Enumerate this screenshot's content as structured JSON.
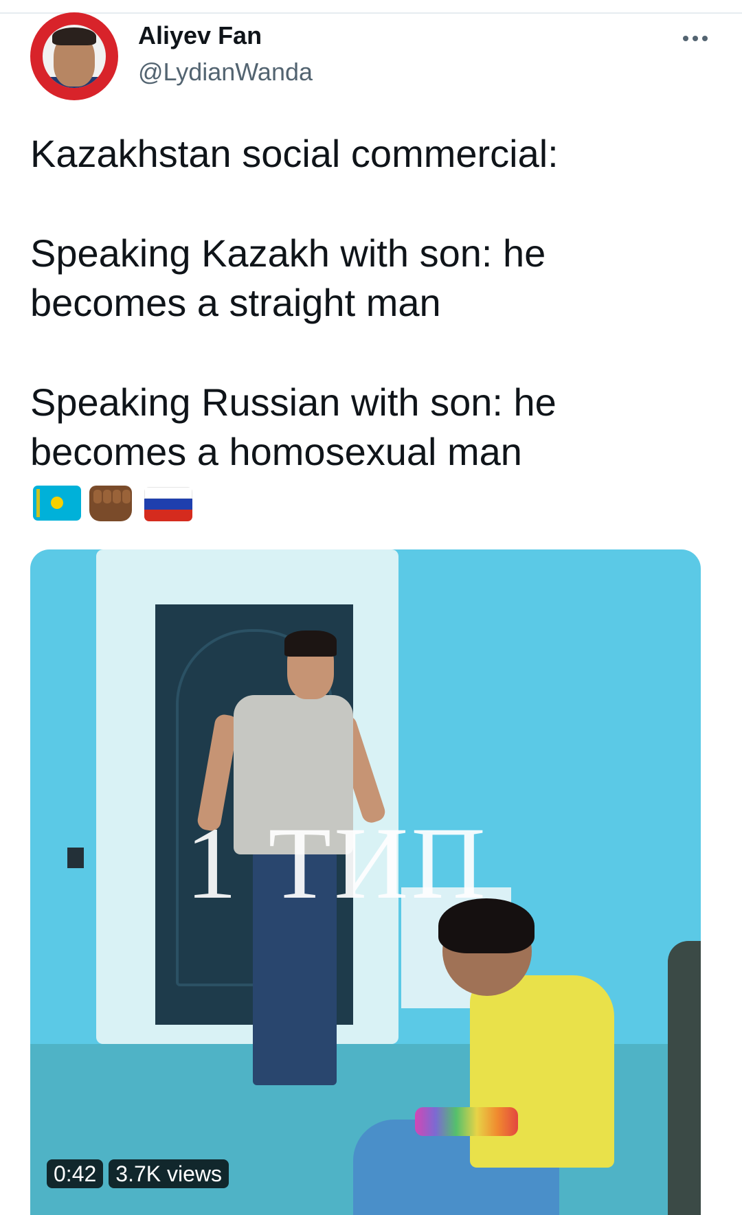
{
  "author": {
    "display_name": "Aliyev Fan",
    "handle": "@LydianWanda"
  },
  "tweet": {
    "line1": "Kazakhstan social commercial:",
    "para2_line1": "Speaking Kazakh with son: he",
    "para2_line2": "becomes a straight man",
    "para3_line1": "Speaking Russian with son: he",
    "para3_line2": "becomes a homosexual man",
    "emojis": [
      "flag-kazakhstan-icon",
      "raised-fist-icon",
      "flag-russia-icon"
    ]
  },
  "media": {
    "overlay_text": "1 ТИП",
    "duration": "0:42",
    "views": "3.7K views"
  },
  "colors": {
    "text_primary": "#0f1419",
    "text_secondary": "#536471",
    "divider": "#e6ecf0",
    "badge_bg": "#000000"
  }
}
